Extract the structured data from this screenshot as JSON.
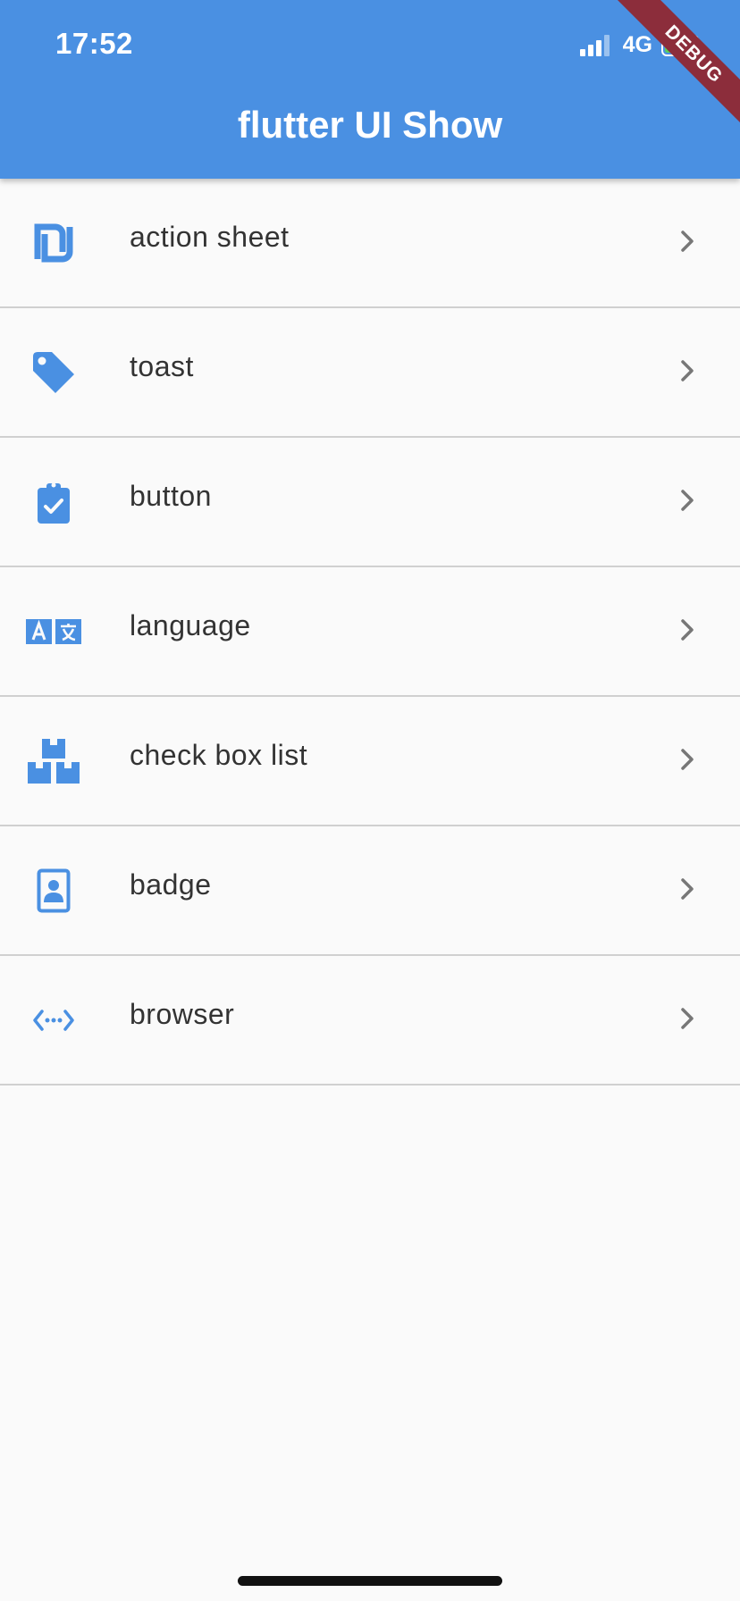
{
  "status_bar": {
    "time": "17:52",
    "network": "4G"
  },
  "app_bar": {
    "title": "flutter UI Show",
    "debug_banner": "DEBUG",
    "color": "#4a90e2"
  },
  "list": [
    {
      "label": "action sheet",
      "icon": "shekel-icon"
    },
    {
      "label": "toast",
      "icon": "tag-icon"
    },
    {
      "label": "button",
      "icon": "clipboard-check-icon"
    },
    {
      "label": "language",
      "icon": "translate-icon"
    },
    {
      "label": "check box list",
      "icon": "boxes-icon"
    },
    {
      "label": "badge",
      "icon": "id-badge-icon"
    },
    {
      "label": "browser",
      "icon": "code-dots-icon"
    }
  ],
  "chevron_icon": "chevron-right-icon"
}
